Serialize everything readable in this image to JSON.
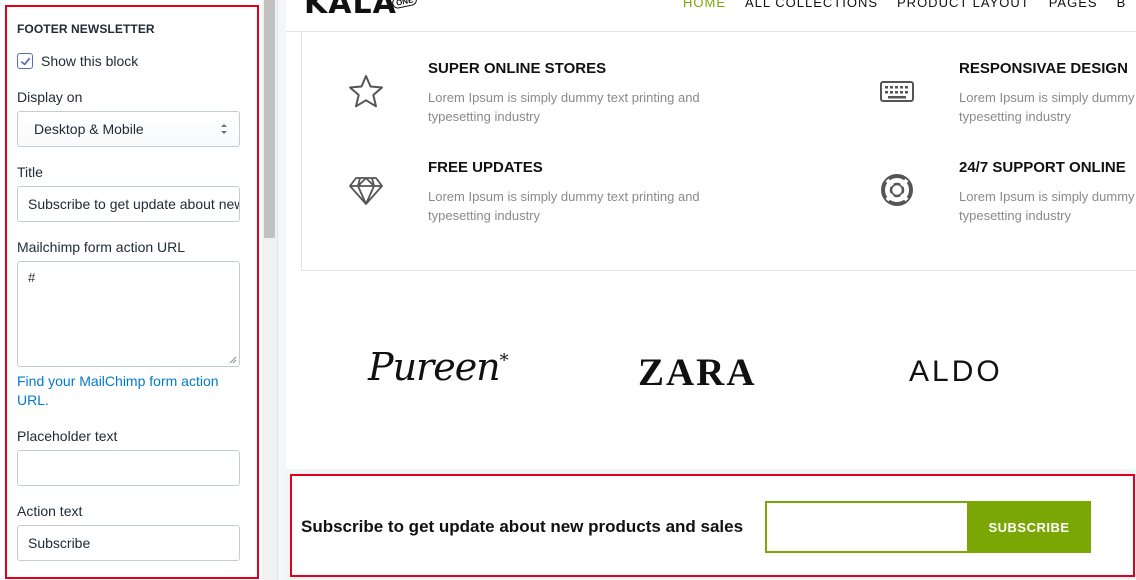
{
  "sidebar": {
    "section_title": "FOOTER NEWSLETTER",
    "show_block_label": "Show this block",
    "show_block_checked": true,
    "display_on_label": "Display on",
    "display_on_value": "Desktop & Mobile",
    "title_label": "Title",
    "title_value": "Subscribe to get update about new products and sales",
    "mailchimp_label": "Mailchimp form action URL",
    "mailchimp_value": "#",
    "help_link": "Find your MailChimp form action URL.",
    "placeholder_label": "Placeholder text",
    "placeholder_value": "",
    "action_label": "Action text",
    "action_value": "Subscribe"
  },
  "preview": {
    "logo": "KALA",
    "logo_badge": "ONE",
    "nav": [
      "HOME",
      "ALL COLLECTIONS",
      "PRODUCT LAYOUT",
      "PAGES",
      "B"
    ],
    "nav_active_index": 0,
    "features": [
      {
        "icon": "star-icon",
        "title": "SUPER ONLINE STORES",
        "desc": "Lorem Ipsum is simply dummy text printing and typesetting industry"
      },
      {
        "icon": "keyboard-icon",
        "title": "RESPONSIVAE DESIGN",
        "desc": "Lorem Ipsum is simply dummy text printing and typesetting industry"
      },
      {
        "icon": "diamond-icon",
        "title": "FREE UPDATES",
        "desc": "Lorem Ipsum is simply dummy text printing and typesetting industry"
      },
      {
        "icon": "lifebuoy-icon",
        "title": "24/7 SUPPORT ONLINE",
        "desc": "Lorem Ipsum is simply dummy text printing and typesetting industry"
      }
    ],
    "brands": [
      "Pureen",
      "ZARA",
      "ALDO"
    ],
    "newsletter_text": "Subscribe to get update about new products and sales",
    "subscribe_button": "SUBSCRIBE"
  },
  "colors": {
    "accent_green": "#7ba705",
    "highlight_red": "#e3001b",
    "link_blue": "#007ace",
    "checkbox_blue": "#5c6ac4"
  }
}
